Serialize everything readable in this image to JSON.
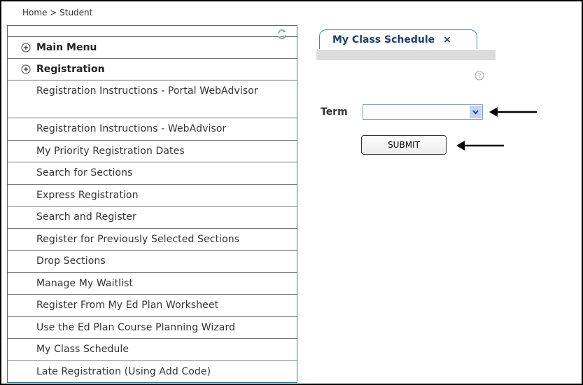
{
  "breadcrumb": "Home > Student",
  "sidebar": {
    "main_menu": "Main Menu",
    "registration": "Registration",
    "items": [
      {
        "label": "Registration Instructions - Portal WebAdvisor"
      },
      {
        "label": "Registration Instructions - WebAdvisor"
      },
      {
        "label": "My Priority Registration Dates"
      },
      {
        "label": "Search for Sections"
      },
      {
        "label": "Express Registration"
      },
      {
        "label": "Search and Register"
      },
      {
        "label": "Register for Previously Selected Sections"
      },
      {
        "label": "Drop Sections"
      },
      {
        "label": "Manage My Waitlist"
      },
      {
        "label": "Register From My Ed Plan Worksheet"
      },
      {
        "label": "Use the Ed Plan Course Planning Wizard"
      },
      {
        "label": "My Class Schedule"
      },
      {
        "label": "Late Registration (Using Add Code)"
      }
    ]
  },
  "tab": {
    "title": "My Class Schedule",
    "close": "×"
  },
  "form": {
    "term_label": "Term",
    "term_value": "",
    "submit_label": "SUBMIT"
  },
  "icons": {
    "refresh": "refresh-icon",
    "expand": "plus-circle-icon",
    "help": "help-icon",
    "dropdown": "chevron-down-icon",
    "annotation": "arrow-left-icon"
  },
  "colors": {
    "sidebar_border": "#2b7a8c",
    "tab_text": "#1a3f73",
    "select_button": "#c3d3fd"
  }
}
